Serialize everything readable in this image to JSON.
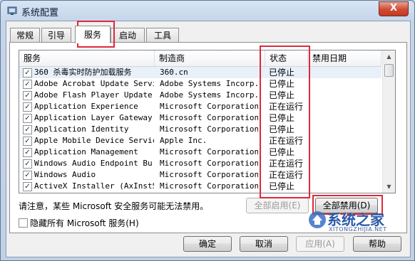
{
  "window": {
    "title": "系统配置",
    "close_glyph": "X"
  },
  "tabs": [
    "常规",
    "引导",
    "服务",
    "启动",
    "工具"
  ],
  "active_tab": "服务",
  "table": {
    "columns": [
      "服务",
      "制造商",
      "状态",
      "禁用日期"
    ],
    "rows": [
      {
        "checked": true,
        "service": "360 杀毒实时防护加载服务",
        "manufacturer": "360.cn",
        "status": "已停止",
        "disable_date": ""
      },
      {
        "checked": true,
        "service": "Adobe Acrobat Update Service",
        "manufacturer": "Adobe Systems Incorp...",
        "status": "已停止",
        "disable_date": ""
      },
      {
        "checked": true,
        "service": "Adobe Flash Player Update...",
        "manufacturer": "Adobe Systems Incorp...",
        "status": "已停止",
        "disable_date": ""
      },
      {
        "checked": true,
        "service": "Application Experience",
        "manufacturer": "Microsoft Corporation",
        "status": "正在运行",
        "disable_date": ""
      },
      {
        "checked": true,
        "service": "Application Layer Gateway...",
        "manufacturer": "Microsoft Corporation",
        "status": "已停止",
        "disable_date": ""
      },
      {
        "checked": true,
        "service": "Application Identity",
        "manufacturer": "Microsoft Corporation",
        "status": "已停止",
        "disable_date": ""
      },
      {
        "checked": true,
        "service": "Apple Mobile Device Service",
        "manufacturer": "Apple Inc.",
        "status": "正在运行",
        "disable_date": ""
      },
      {
        "checked": true,
        "service": "Application Management",
        "manufacturer": "Microsoft Corporation",
        "status": "已停止",
        "disable_date": ""
      },
      {
        "checked": true,
        "service": "Windows Audio Endpoint Bu...",
        "manufacturer": "Microsoft Corporation",
        "status": "正在运行",
        "disable_date": ""
      },
      {
        "checked": true,
        "service": "Windows Audio",
        "manufacturer": "Microsoft Corporation",
        "status": "正在运行",
        "disable_date": ""
      },
      {
        "checked": true,
        "service": "ActiveX Installer (AxInstSV)",
        "manufacturer": "Microsoft Corporation",
        "status": "已停止",
        "disable_date": ""
      }
    ]
  },
  "note": "请注意，某些 Microsoft 安全服务可能无法禁用。",
  "buttons": {
    "enable_all": "全部启用(E)",
    "disable_all": "全部禁用(D)",
    "ok": "确定",
    "cancel": "取消",
    "apply": "应用(A)",
    "help": "帮助"
  },
  "hide_ms_label": "隐藏所有 Microsoft 服务(H)",
  "watermark": {
    "text": "系统之家",
    "url": "XITONGZHIJIA.NET"
  },
  "colors": {
    "highlight_box": "#e0283a",
    "title_bar": "#c4d5ea",
    "close_button": "#cf4a33"
  }
}
